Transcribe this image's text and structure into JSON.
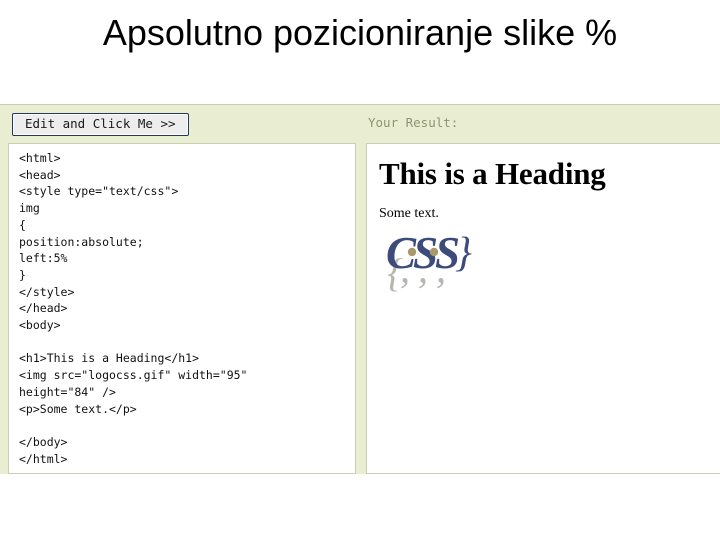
{
  "slide": {
    "title": "Apsolutno pozicioniranje slike %"
  },
  "editor": {
    "edit_button_label": "Edit and Click Me >>",
    "result_label": "Your Result:",
    "code": "<html>\n<head>\n<style type=\"text/css\">\nimg\n{\nposition:absolute;\nleft:5%\n}\n</style>\n</head>\n<body>\n\n<h1>This is a Heading</h1>\n<img src=\"logocss.gif\" width=\"95\"\nheight=\"84\" />\n<p>Some text.</p>\n\n</body>\n</html>"
  },
  "result": {
    "heading": "This is a Heading",
    "paragraph": "Some text.",
    "image_alt": "logocss.gif",
    "image_width": "95",
    "image_height": "84"
  },
  "colors": {
    "panel_background": "#e9eed2",
    "pane_border": "#c9cfb0",
    "result_label_text": "#8d9470",
    "button_border": "#203a5e",
    "logo_blue": "#3c4b7c",
    "logo_dot": "#a89a6a",
    "logo_shadow": "#9a9a93"
  }
}
